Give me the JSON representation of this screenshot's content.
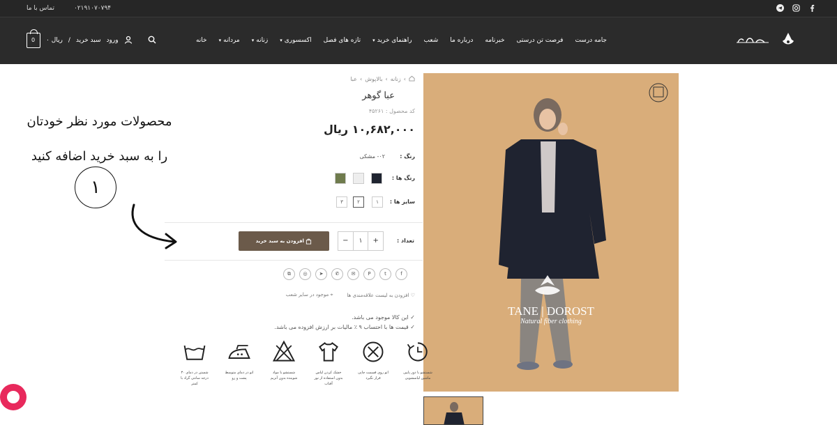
{
  "topbar": {
    "phone": "۰۲۱۹۱۰۷۰۷۹۴",
    "contact": "تماس با ما",
    "social": [
      "facebook-icon",
      "instagram-icon",
      "telegram-icon"
    ]
  },
  "nav": {
    "items": [
      "خانه",
      "مردانه",
      "زنانه",
      "اکسسوری",
      "تازه های فصل",
      "راهنمای خرید",
      "شعب",
      "درباره ما",
      "خبرنامه",
      "فرصت تن درستی",
      "جامه درست"
    ],
    "login": "ورود",
    "cart_label": "سبد خرید",
    "cart_total": "۰ ریال",
    "cart_count": "0"
  },
  "product": {
    "breadcrumb": [
      "زنانه",
      "بالاپوش",
      "عبا"
    ],
    "title": "عبا گوهر",
    "code": "کد محصول : ۴۵۲۶۱",
    "price": "۱۰,۶۸۲,۰۰۰ ریال",
    "color_label": "رنگ :",
    "color_value": "۰۲- مشکی",
    "colors_label": "رنگ ها :",
    "swatches": [
      "#1f2430",
      "#eeeeee",
      "#6f7b4d"
    ],
    "sizes_label": "سایز ها :",
    "sizes": [
      "۱",
      "۲",
      "۳"
    ],
    "qty_label": "تعداد :",
    "qty_value": "۱",
    "add_to_cart": "افزودن به سبد خرید",
    "wishlist": "افزودن به لیست علاقه‌مندی ها",
    "stores": "موجود در سایر شعب",
    "notes": [
      "این کالا موجود می باشد.",
      "قیمت ها با احتساب ۹ ٪ مالیات بر ارزش افزوده می باشد."
    ],
    "watermark": "TANE | DOROST",
    "watermark_sub": "Natural fiber clothing"
  },
  "care": [
    "شستشو با دور پایین ماشین لباسشویی",
    "اتو روی قسمت چاپی قرار نگیرد",
    "خشک کردن لباس بدون استفاده از نور آفتاب",
    "شستشو با مواد شوینده بدون آنزیم",
    "اتو در دمای متوسط پشت و رو",
    "شستن در دمای ۳۰ درجه سانتی گراد با کمتر"
  ],
  "annotation": {
    "line1": "محصولات مورد نظر خودتان",
    "line2": "را به سبد خرید اضافه کنید",
    "number": "۱"
  }
}
